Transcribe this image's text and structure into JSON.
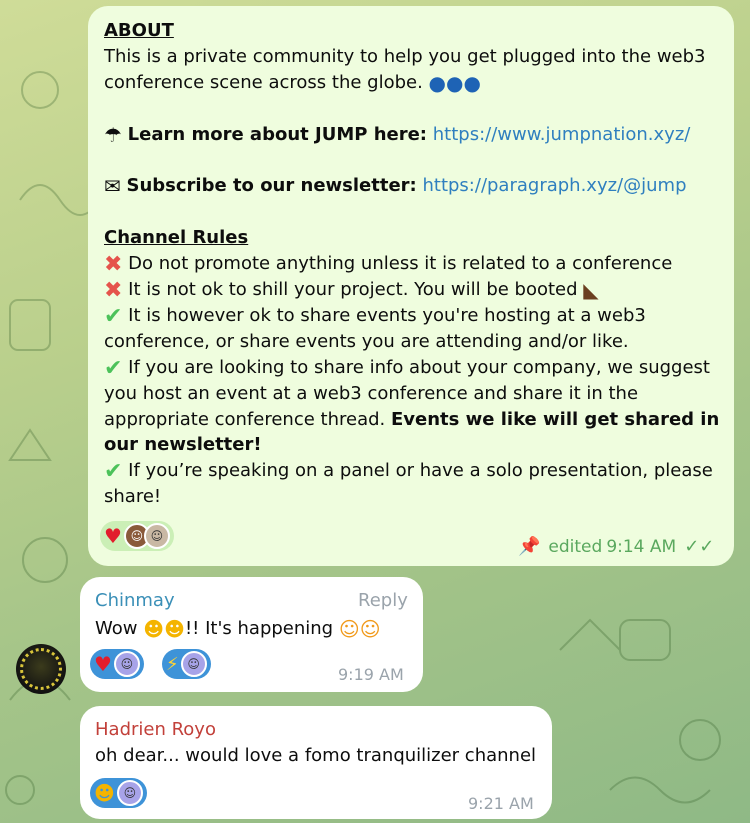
{
  "pinned_message": {
    "lines": {
      "about": "ABOUT",
      "l1": "This is a private community to help you get plugged into the web3",
      "l2": "conference scene across the globe.",
      "learn_label": "Learn more about JUMP here:",
      "learn_link": "https://www.jumpnation.xyz/",
      "subscribe_label": "Subscribe to our newsletter:",
      "subscribe_link": "https://paragraph.xyz/@jump",
      "rules_title": "Channel Rules",
      "r1": "Do not promote anything unless it is related to a conference",
      "r2": "It is not ok to shill your project. You will be booted",
      "r3a": "It is however ok to share events you're hosting at a web3",
      "r3b": "conference, or share events you are attending and/or like.",
      "r4a": "If you are looking to share info about your company, we suggest",
      "r4b": "you host an event at a web3 conference and share it in the",
      "r4c": "appropriate conference thread.",
      "r4d": "Events we like will get shared in",
      "r4e": "our newsletter!",
      "r5a": "If you’re speaking on a panel or have a solo presentation, please",
      "r5b": "share!"
    },
    "meta": {
      "status": "edited",
      "time": "9:14 AM"
    },
    "icons": [
      "parachute",
      "mailbox",
      "cross-mark",
      "check-mark",
      "boot",
      "globe",
      "pin",
      "double-check"
    ]
  },
  "messages": [
    {
      "sender": "Chinmay",
      "reply_label": "Reply",
      "text_a": "Wow",
      "text_b": "!! It's happening",
      "time": "9:19 AM"
    },
    {
      "sender": "Hadrien Royo",
      "text": "oh dear... would love a fomo tranquilizer channel",
      "time": "9:21 AM"
    }
  ],
  "colors": {
    "own_bubble": "#effdde",
    "incoming_bubble": "#ffffff",
    "link": "#2f7fbf",
    "chinmay_name": "#3a8fb7",
    "hadrien_name": "#c2403a",
    "meta_green": "#5aa85e",
    "reaction_blue": "#3e93d8"
  }
}
